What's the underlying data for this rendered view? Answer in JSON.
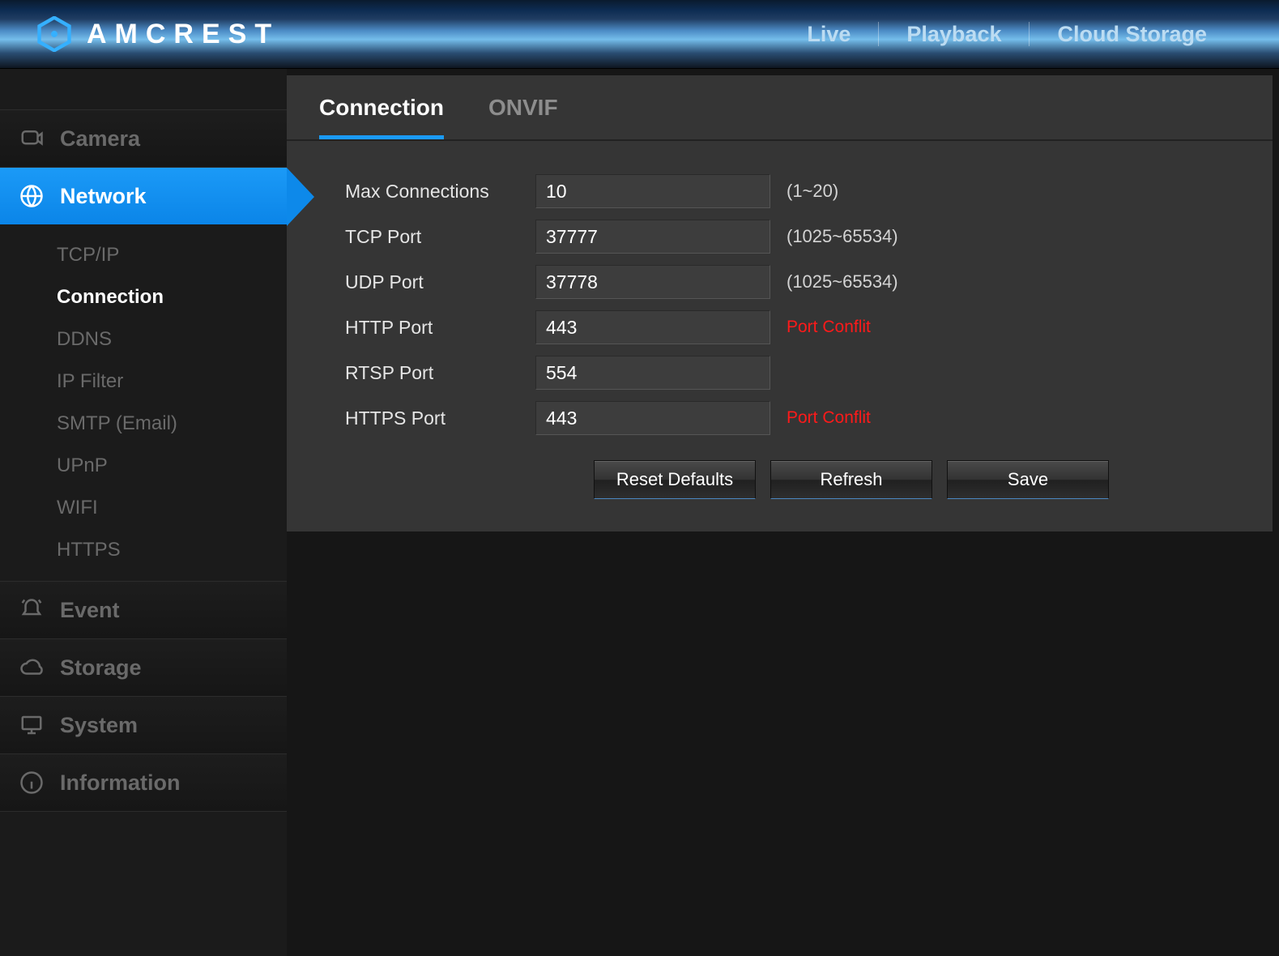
{
  "brand": "AMCREST",
  "topnav": {
    "live": "Live",
    "playback": "Playback",
    "cloud": "Cloud Storage"
  },
  "sidebar": {
    "camera": "Camera",
    "network": "Network",
    "event": "Event",
    "storage": "Storage",
    "system": "System",
    "information": "Information",
    "network_subs": {
      "tcpip": "TCP/IP",
      "connection": "Connection",
      "ddns": "DDNS",
      "ipfilter": "IP Filter",
      "smtp": "SMTP (Email)",
      "upnp": "UPnP",
      "wifi": "WIFI",
      "https": "HTTPS"
    }
  },
  "tabs": {
    "connection": "Connection",
    "onvif": "ONVIF"
  },
  "form": {
    "max_conn": {
      "label": "Max Connections",
      "value": "10",
      "hint": "(1~20)"
    },
    "tcp_port": {
      "label": "TCP Port",
      "value": "37777",
      "hint": "(1025~65534)"
    },
    "udp_port": {
      "label": "UDP Port",
      "value": "37778",
      "hint": "(1025~65534)"
    },
    "http_port": {
      "label": "HTTP Port",
      "value": "443",
      "hint": "Port Conflit"
    },
    "rtsp_port": {
      "label": "RTSP Port",
      "value": "554",
      "hint": ""
    },
    "https_port": {
      "label": "HTTPS Port",
      "value": "443",
      "hint": "Port Conflit"
    }
  },
  "buttons": {
    "reset": "Reset Defaults",
    "refresh": "Refresh",
    "save": "Save"
  }
}
